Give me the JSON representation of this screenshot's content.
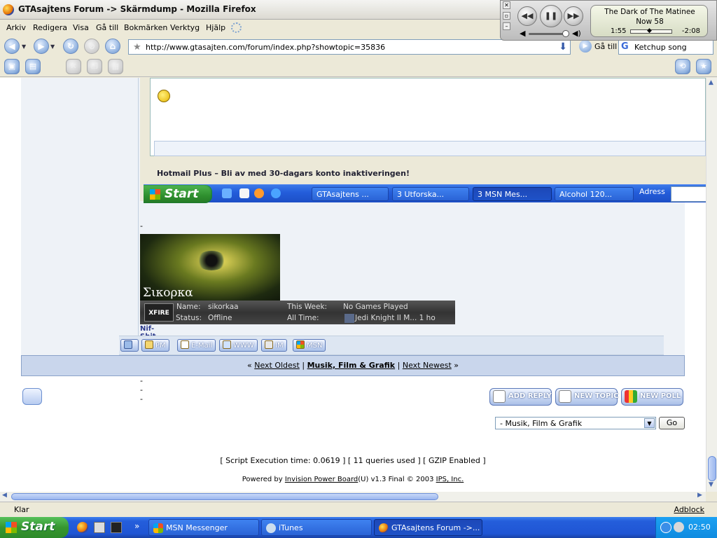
{
  "window": {
    "title": "GTAsajtens Forum -> Skärmdump - Mozilla Firefox"
  },
  "menu": [
    "Arkiv",
    "Redigera",
    "Visa",
    "Gå till",
    "Bokmärken",
    "Verktyg",
    "Hjälp"
  ],
  "nav": {
    "url": "http://www.gtasajten.com/forum/index.php?showtopic=35836",
    "go_label": "Gå till",
    "search_value": "Ketchup song"
  },
  "itunes": {
    "song": "The Dark of The Matinee",
    "line2": "Now 58",
    "elapsed": "1:55",
    "remaining": "-2:08"
  },
  "screenshot": {
    "hotmail_text": "Hotmail Plus – Bli av med 30-dagars konto inaktiveringen!",
    "start_label": "Start",
    "tasks": [
      "GTAsajtens ...",
      "3 Utforska...",
      "3 MSN Mes...",
      "Alcohol 120..."
    ],
    "address_label": "Adress"
  },
  "post": {
    "dashes": "--------------------",
    "sig_name": "Σικορκα",
    "xfire": {
      "logo": "XFIRE",
      "name_label": "Name:",
      "name_value": "sikorkaa",
      "status_label": "Status:",
      "status_value": "Offline",
      "week_label": "This Week:",
      "week_value": "No Games Played",
      "alltime_label": "All Time:",
      "alltime_value": "Jedi Knight II M... 1 ho"
    },
    "nif": "Nif-Shit...",
    "buttons": [
      "PM",
      "E-Mail",
      "WWW",
      "IM",
      "MSN"
    ]
  },
  "topicnav": {
    "prefix": "«",
    "next_oldest": "Next Oldest",
    "sep": "|",
    "forum": "Musik, Film & Grafik",
    "next_newest": "Next Newest",
    "suffix": "»"
  },
  "actions": {
    "add_reply": "ADD REPLY",
    "new_topic": "NEW TOPIC",
    "new_poll": "NEW POLL"
  },
  "jump": {
    "selected": "- Musik, Film & Grafik",
    "go": "Go"
  },
  "footer": {
    "stats": "[ Script Execution time: 0.0619 ]   [ 11 queries used ]   [ GZIP Enabled ]",
    "powered_prefix": "Powered by",
    "powered_link": "Invision Power Board",
    "powered_mid": "(U) v1.3 Final © 2003",
    "ips": "IPS, Inc."
  },
  "status": {
    "text": "Klar",
    "adblock": "Adblock"
  },
  "taskbar": {
    "start": "Start",
    "tasks": [
      "MSN Messenger",
      "iTunes",
      "GTAsajtens Forum ->..."
    ],
    "clock": "02:50"
  }
}
